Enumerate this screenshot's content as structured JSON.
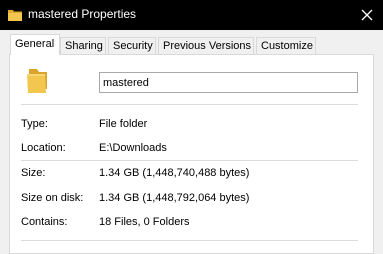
{
  "window": {
    "title": "mastered Properties"
  },
  "tabs": [
    {
      "label": "General",
      "active": true
    },
    {
      "label": "Sharing"
    },
    {
      "label": "Security"
    },
    {
      "label": "Previous Versions"
    },
    {
      "label": "Customize"
    }
  ],
  "general": {
    "name_value": "mastered",
    "rows": [
      {
        "label": "Type:",
        "value": "File folder"
      },
      {
        "label": "Location:",
        "value": "E:\\Downloads"
      },
      {
        "label": "Size:",
        "value": "1.34 GB (1,448,740,488 bytes)"
      },
      {
        "label": "Size on disk:",
        "value": "1.34 GB (1,448,792,064 bytes)"
      },
      {
        "label": "Contains:",
        "value": "18 Files, 0 Folders"
      }
    ]
  },
  "icons": {
    "title": "folder-icon",
    "close": "close-icon",
    "large": "folder-icon"
  },
  "colors": {
    "titlebar_bg": "#000000",
    "folder_yellow": "#f3c74f",
    "window_bg": "#f0f0f0"
  }
}
